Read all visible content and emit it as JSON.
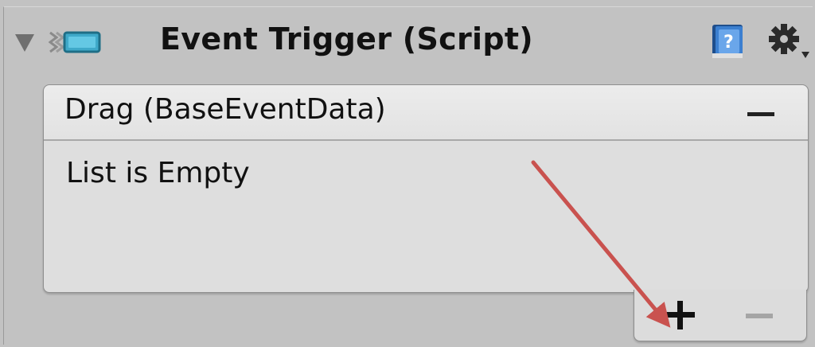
{
  "component": {
    "title": "Event Trigger (Script)",
    "expanded": true,
    "icons": {
      "foldout": "triangle-down-icon",
      "script": "script-icon",
      "help": "help-book-icon",
      "settings": "gear-icon"
    }
  },
  "event_entry": {
    "title": "Drag (BaseEventData)",
    "remove_icon": "minus-icon",
    "list_status": "List is Empty"
  },
  "list_footer": {
    "add_icon": "plus-icon",
    "remove_icon": "minus-icon",
    "remove_enabled": false
  },
  "annotation": {
    "type": "arrow",
    "color": "#c9524f",
    "points_to": "add-event-listener-button"
  }
}
